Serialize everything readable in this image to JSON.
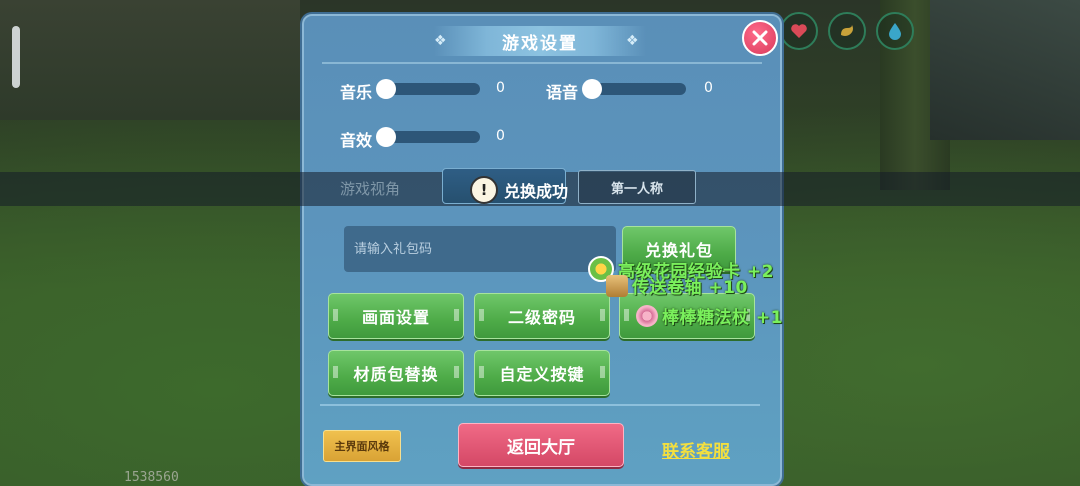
{
  "hud": {
    "debug_number": "1538560",
    "status_icons": [
      "heart-icon",
      "stomach-icon",
      "water-drop-icon"
    ]
  },
  "panel": {
    "title": "游戏设置",
    "sliders": {
      "music": {
        "label": "音乐",
        "value": "0",
        "level": 0
      },
      "voice": {
        "label": "语音",
        "value": "0",
        "level": 0
      },
      "sfx": {
        "label": "音效",
        "value": "0",
        "level": 0
      }
    },
    "view": {
      "label": "游戏视角",
      "selected_option": "第一人称"
    },
    "toast": {
      "text": "兑换成功"
    },
    "gift_code": {
      "placeholder": "请输入礼包码",
      "value": ""
    },
    "buttons": {
      "redeem": "兑换礼包",
      "graphics": "画面设置",
      "second_password": "二级密码",
      "texture_pack": "材质包替换",
      "custom_keys": "自定义按键"
    },
    "footer": {
      "style": "主界面风格",
      "return_lobby": "返回大厅",
      "contact_service": "联系客服"
    }
  },
  "rewards": [
    {
      "text": "高级花园经验卡 +2",
      "icon": "sunflower-card-icon"
    },
    {
      "text": "传送卷轴 +10",
      "icon": "scroll-icon"
    },
    {
      "text": "棒棒糖法杖 +1",
      "icon": "lollipop-wand-icon"
    }
  ],
  "colors": {
    "panel": "#5c95bd",
    "green_button": "#4eab48",
    "pink_button": "#d44866",
    "reward_text": "#7af05c",
    "link": "#f3df3f"
  }
}
